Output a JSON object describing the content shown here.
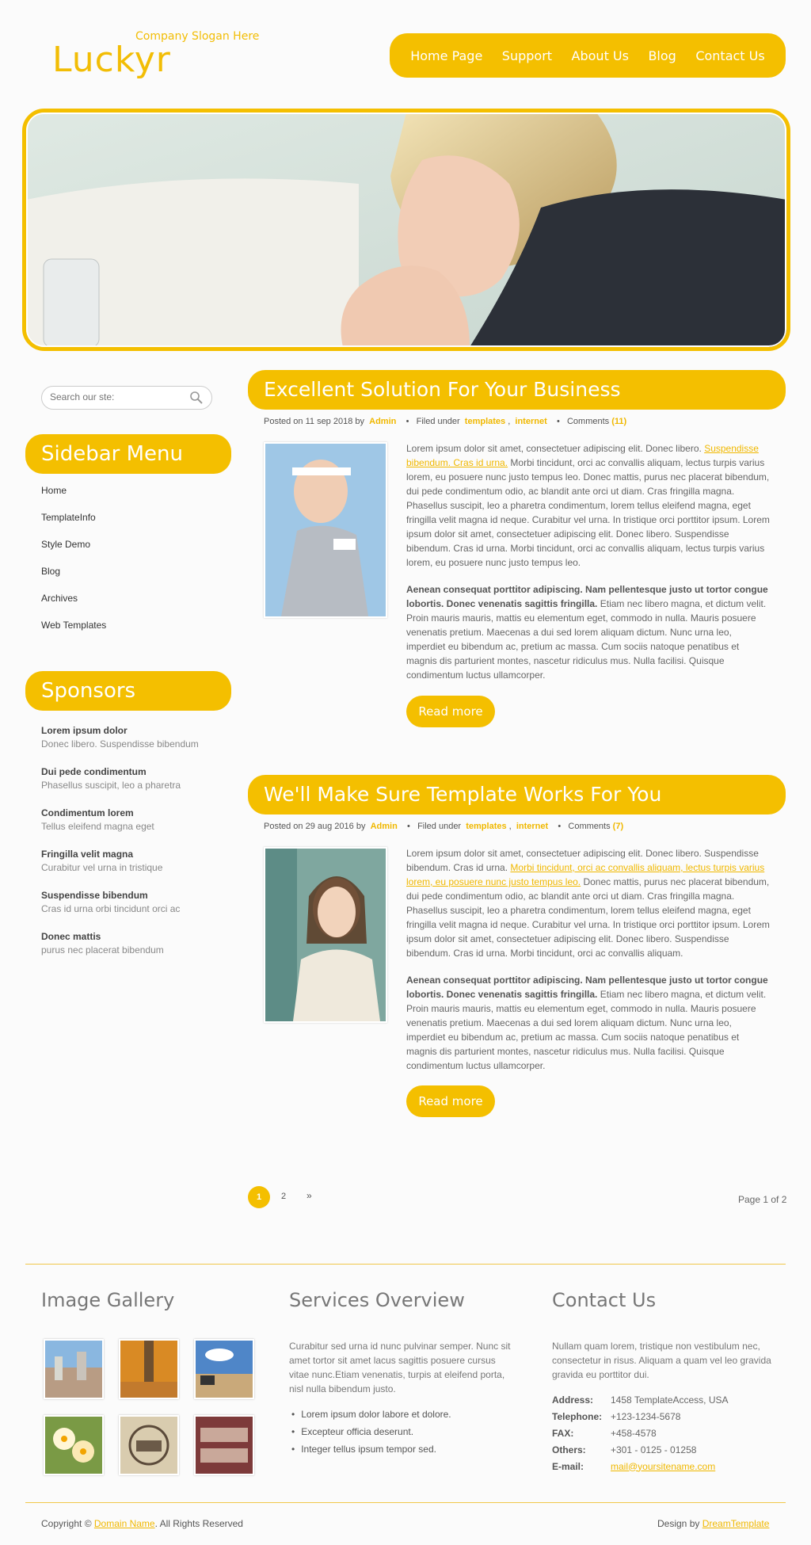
{
  "header": {
    "logo": "Luckyr",
    "slogan": "Company Slogan Here",
    "nav": [
      "Home Page",
      "Support",
      "About Us",
      "Blog",
      "Contact Us"
    ]
  },
  "search": {
    "placeholder": "Search our ste:"
  },
  "sidebar": {
    "menu_title": "Sidebar Menu",
    "menu": [
      "Home",
      "TemplateInfo",
      "Style Demo",
      "Blog",
      "Archives",
      "Web Templates"
    ],
    "sponsors_title": "Sponsors",
    "sponsors": [
      {
        "title": "Lorem ipsum dolor",
        "sub": "Donec libero. Suspendisse bibendum"
      },
      {
        "title": "Dui pede condimentum",
        "sub": "Phasellus suscipit, leo a pharetra"
      },
      {
        "title": "Condimentum lorem",
        "sub": "Tellus eleifend magna eget"
      },
      {
        "title": "Fringilla velit magna",
        "sub": "Curabitur vel urna in tristique"
      },
      {
        "title": "Suspendisse bibendum",
        "sub": "Cras id urna orbi tincidunt orci ac"
      },
      {
        "title": "Donec mattis",
        "sub": "purus nec placerat bibendum"
      }
    ]
  },
  "posts": [
    {
      "title": "Excellent Solution For Your Business",
      "posted": "Posted on 11 sep 2018 by",
      "author": "Admin",
      "filed": "Filed under",
      "cat1": "templates",
      "cat2": "internet",
      "comments": "Comments",
      "count": "(11)",
      "p1a": "Lorem ipsum dolor sit amet, consectetuer adipiscing elit. Donec libero.",
      "p1link": "Suspendisse bibendum. Cras id urna.",
      "p1b": "Morbi tincidunt, orci ac convallis aliquam, lectus turpis varius lorem, eu posuere nunc justo tempus leo. Donec mattis, purus nec placerat bibendum, dui pede condimentum odio, ac blandit ante orci ut diam. Cras fringilla magna. Phasellus suscipit, leo a pharetra condimentum, lorem tellus eleifend magna, eget fringilla velit magna id neque. Curabitur vel urna. In tristique orci porttitor ipsum. Lorem ipsum dolor sit amet, consectetuer adipiscing elit. Donec libero. Suspendisse bibendum. Cras id urna. Morbi tincidunt, orci ac convallis aliquam, lectus turpis varius lorem, eu posuere nunc justo tempus leo.",
      "p2bold": "Aenean consequat porttitor adipiscing. Nam pellentesque justo ut tortor congue lobortis. Donec venenatis sagittis fringilla.",
      "p2": "Etiam nec libero magna, et dictum velit. Proin mauris mauris, mattis eu elementum eget, commodo in nulla. Mauris posuere venenatis pretium. Maecenas a dui sed lorem aliquam dictum. Nunc urna leo, imperdiet eu bibendum ac, pretium ac massa. Cum sociis natoque penatibus et magnis dis parturient montes, nascetur ridiculus mus. Nulla facilisi. Quisque condimentum luctus ullamcorper.",
      "readmore": "Read more"
    },
    {
      "title": "We'll Make Sure Template Works For You",
      "posted": "Posted on 29 aug 2016 by",
      "author": "Admin",
      "filed": "Filed under",
      "cat1": "templates",
      "cat2": "internet",
      "comments": "Comments",
      "count": "(7)",
      "p1a": "Lorem ipsum dolor sit amet, consectetuer adipiscing elit. Donec libero. Suspendisse bibendum. Cras id urna.",
      "p1link": "Morbi tincidunt, orci ac convallis aliquam, lectus turpis varius lorem, eu posuere nunc justo tempus leo.",
      "p1b": "Donec mattis, purus nec placerat bibendum, dui pede condimentum odio, ac blandit ante orci ut diam. Cras fringilla magna. Phasellus suscipit, leo a pharetra condimentum, lorem tellus eleifend magna, eget fringilla velit magna id neque. Curabitur vel urna. In tristique orci porttitor ipsum. Lorem ipsum dolor sit amet, consectetuer adipiscing elit. Donec libero. Suspendisse bibendum. Cras id urna. Morbi tincidunt, orci ac convallis aliquam.",
      "p2bold": "Aenean consequat porttitor adipiscing. Nam pellentesque justo ut tortor congue lobortis. Donec venenatis sagittis fringilla.",
      "p2": "Etiam nec libero magna, et dictum velit. Proin mauris mauris, mattis eu elementum eget, commodo in nulla. Mauris posuere venenatis pretium. Maecenas a dui sed lorem aliquam dictum. Nunc urna leo, imperdiet eu bibendum ac, pretium ac massa. Cum sociis natoque penatibus et magnis dis parturient montes, nascetur ridiculus mus. Nulla facilisi. Quisque condimentum luctus ullamcorper.",
      "readmore": "Read more"
    }
  ],
  "pagination": {
    "current": "1",
    "next": "2",
    "arrow": "»",
    "label": "Page 1 of 2"
  },
  "footer": {
    "gallery_title": "Image Gallery",
    "services_title": "Services Overview",
    "services_text": "Curabitur sed urna id nunc pulvinar semper. Nunc sit amet tortor sit amet lacus sagittis posuere cursus vitae nunc.Etiam venenatis, turpis at eleifend porta, nisl nulla bibendum justo.",
    "services_list": [
      "Lorem ipsum dolor labore et dolore.",
      "Excepteur officia deserunt.",
      "Integer tellus ipsum tempor sed."
    ],
    "contact_title": "Contact Us",
    "contact_text": "Nullam quam lorem, tristique non vestibulum nec, consectetur in risus. Aliquam a quam vel leo gravida gravida eu porttitor dui.",
    "contact": [
      {
        "label": "Address:",
        "value": "1458 TemplateAccess, USA"
      },
      {
        "label": "Telephone:",
        "value": "+123-1234-5678"
      },
      {
        "label": "FAX:",
        "value": "+458-4578"
      },
      {
        "label": "Others:",
        "value": "+301 - 0125 - 01258"
      },
      {
        "label": "E-mail:",
        "value": "mail@yoursitename.com"
      }
    ],
    "copyright_pre": "Copyright ©",
    "copyright_link": "Domain Name",
    "copyright_post": ". All Rights Reserved",
    "design_pre": "Design by",
    "design_link": "DreamTemplate"
  },
  "colors": {
    "accent": "#f4bf00",
    "text": "#666666",
    "background": "#fbfbfb"
  }
}
